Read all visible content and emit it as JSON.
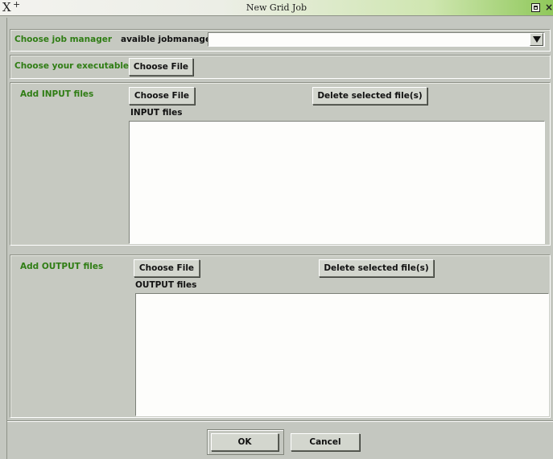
{
  "window": {
    "title": "New Grid Job",
    "menu_glyph": "X",
    "pin_glyph": "+"
  },
  "jobmanager": {
    "section_label": "Choose job manager",
    "field_label": "avaible jobmanager",
    "selected_value": ""
  },
  "executable": {
    "section_label": "Choose your executable",
    "choose_button": "Choose File"
  },
  "input": {
    "section_label": "Add INPUT files",
    "choose_button": "Choose File",
    "delete_button": "Delete selected file(s)",
    "list_label": "INPUT files",
    "files": []
  },
  "output": {
    "section_label": "Add OUTPUT files",
    "choose_button": "Choose File",
    "delete_button": "Delete selected file(s)",
    "list_label": "OUTPUT files",
    "files": []
  },
  "footer": {
    "ok_button": "OK",
    "cancel_button": "Cancel"
  },
  "colors": {
    "section_label": "#2f7d14",
    "titlebar_accent": "#8fc85a"
  },
  "icons": {
    "window_menu": "x-window-menu-icon",
    "pin": "pin-icon",
    "maximize": "maximize-icon",
    "close": "close-icon",
    "dropdown": "triangle-down-icon"
  }
}
